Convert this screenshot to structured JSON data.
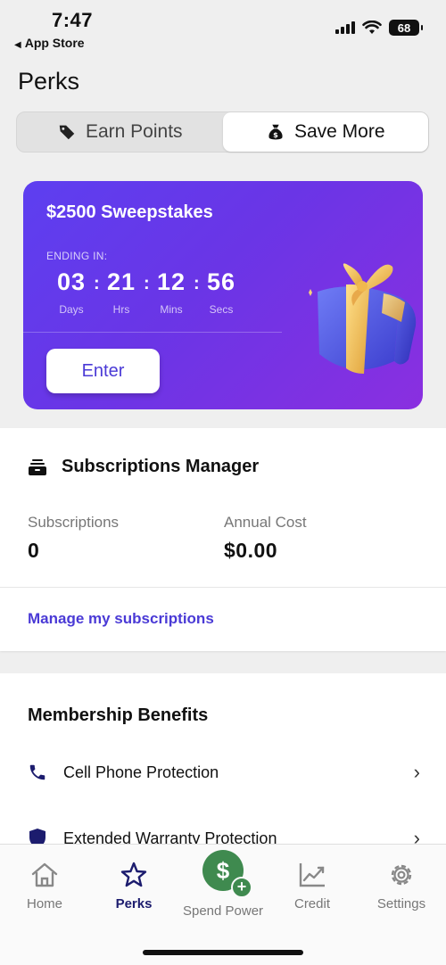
{
  "status_bar": {
    "time": "7:47",
    "back_label": "App Store",
    "battery": "68"
  },
  "page": {
    "title": "Perks"
  },
  "segmented": {
    "earn_label": "Earn Points",
    "save_label": "Save More"
  },
  "sweepstakes": {
    "title": "$2500 Sweepstakes",
    "ending_label": "ENDING IN:",
    "countdown": [
      {
        "value": "03",
        "unit": "Days"
      },
      {
        "value": "21",
        "unit": "Hrs"
      },
      {
        "value": "12",
        "unit": "Mins"
      },
      {
        "value": "56",
        "unit": "Secs"
      }
    ],
    "separator": ":",
    "enter_label": "Enter"
  },
  "subscriptions": {
    "title": "Subscriptions Manager",
    "count_label": "Subscriptions",
    "count_value": "0",
    "cost_label": "Annual Cost",
    "cost_value": "$0.00",
    "manage_label": "Manage my subscriptions"
  },
  "benefits": {
    "title": "Membership Benefits",
    "items": [
      {
        "label": "Cell Phone Protection",
        "icon": "phone-icon"
      },
      {
        "label": "Extended Warranty Protection",
        "icon": "shield-icon"
      }
    ]
  },
  "tab_bar": {
    "items": [
      {
        "label": "Home",
        "icon": "home-icon"
      },
      {
        "label": "Perks",
        "icon": "star-icon"
      },
      {
        "label": "Spend Power",
        "icon": "dollar-plus-icon"
      },
      {
        "label": "Credit",
        "icon": "chart-icon"
      },
      {
        "label": "Settings",
        "icon": "gear-icon"
      }
    ]
  },
  "colors": {
    "accent_purple": "#4a3ad6",
    "card_gradient_start": "#5d3ff0",
    "card_gradient_end": "#8a2fe0",
    "spend_green": "#3f8a4f",
    "active_tab_navy": "#1c1c6e"
  }
}
